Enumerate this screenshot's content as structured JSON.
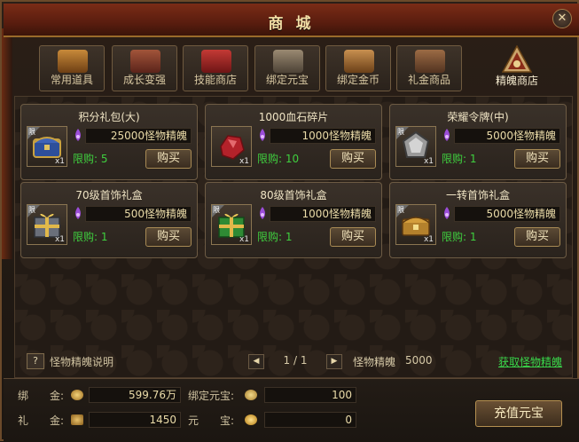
{
  "window": {
    "title": "商 城",
    "close_glyph": "✕"
  },
  "tabs": [
    {
      "label": "常用道具",
      "icon": "chest-icon",
      "color": "#a96a2a"
    },
    {
      "label": "成长变强",
      "icon": "scroll-bundle-icon",
      "color": "#8a3a2a"
    },
    {
      "label": "技能商店",
      "icon": "red-book-icon",
      "color": "#a0282a"
    },
    {
      "label": "绑定元宝",
      "icon": "ingot-pile-icon",
      "color": "#7c6a55"
    },
    {
      "label": "绑定金币",
      "icon": "coin-pile-icon",
      "color": "#a4713a"
    },
    {
      "label": "礼金商品",
      "icon": "gift-pile-icon",
      "color": "#7b5437"
    },
    {
      "label": "精魄商店",
      "icon": "soul-emblem-icon",
      "active": true
    }
  ],
  "items": [
    {
      "name": "积分礼包(大)",
      "icon": "blue-chest-icon",
      "count": "x1",
      "price": "25000怪物精魄",
      "limit": "限购: 5",
      "buy": "购买"
    },
    {
      "name": "1000血石碎片",
      "icon": "blood-stone-icon",
      "count": "x1",
      "price": "1000怪物精魄",
      "limit": "限购: 10",
      "buy": "购买"
    },
    {
      "name": "荣耀令牌(中)",
      "icon": "silver-token-icon",
      "count": "x1",
      "price": "5000怪物精魄",
      "limit": "限购: 1",
      "buy": "购买"
    },
    {
      "name": "70级首饰礼盒",
      "icon": "grey-giftbox-icon",
      "count": "x1",
      "price": "500怪物精魄",
      "limit": "限购: 1",
      "buy": "购买"
    },
    {
      "name": "80级首饰礼盒",
      "icon": "green-giftbox-icon",
      "count": "x1",
      "price": "1000怪物精魄",
      "limit": "限购: 1",
      "buy": "购买"
    },
    {
      "name": "一转首饰礼盒",
      "icon": "gold-chest-icon",
      "count": "x1",
      "price": "5000怪物精魄",
      "limit": "限购: 1",
      "buy": "购买"
    }
  ],
  "limited_badge": "限",
  "footer": {
    "help_glyph": "?",
    "help_text": "怪物精魄说明",
    "page": "1 / 1",
    "prev_glyph": "◀",
    "next_glyph": "▶",
    "souls_label": "怪物精魄",
    "souls_value": "5000",
    "get_link": "获取怪物精魄"
  },
  "currency": {
    "bound_gold_label": "绑　　金:",
    "bound_gold_value": "599.76万",
    "bound_yuanbao_label": "绑定元宝:",
    "bound_yuanbao_value": "100",
    "gift_gold_label": "礼　　金:",
    "gift_gold_value": "1450",
    "yuanbao_label": "元　　宝:",
    "yuanbao_value": "0",
    "charge_button": "充值元宝"
  }
}
